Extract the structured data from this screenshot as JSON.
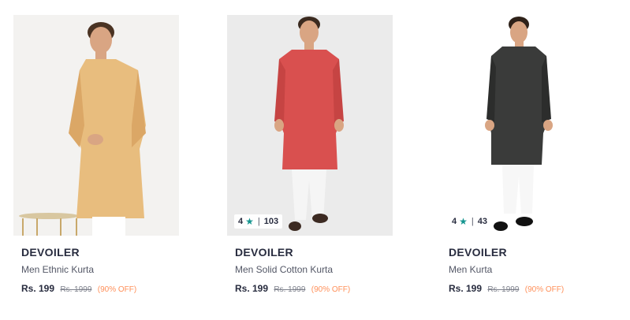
{
  "products": [
    {
      "brand": "DEVOILER",
      "name": "Men Ethnic Kurta",
      "price": "Rs. 199",
      "mrp": "Rs. 1999",
      "discount": "(90% OFF)",
      "kurta_color": "#e8bd7e",
      "background_color": "#f3f2f0"
    },
    {
      "brand": "DEVOILER",
      "name": "Men Solid Cotton Kurta",
      "price": "Rs. 199",
      "mrp": "Rs. 1999",
      "discount": "(90% OFF)",
      "rating": {
        "value": "4",
        "count": "103",
        "star_icon": "star-icon"
      },
      "kurta_color": "#d9504f",
      "background_color": "#ebebeb"
    },
    {
      "brand": "DEVOILER",
      "name": "Men Kurta",
      "price": "Rs. 199",
      "mrp": "Rs. 1999",
      "discount": "(90% OFF)",
      "rating": {
        "value": "4",
        "count": "43",
        "star_icon": "star-icon"
      },
      "kurta_color": "#3a3b3a",
      "background_color": "#ffffff"
    }
  ],
  "colors": {
    "star": "#14958f",
    "discount": "#ff905a",
    "brand_text": "#282c3f"
  }
}
